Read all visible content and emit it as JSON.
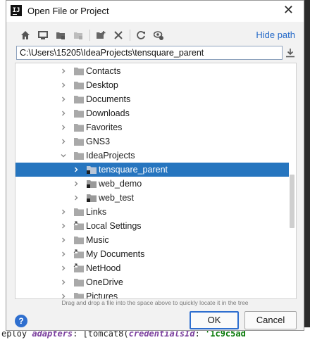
{
  "window": {
    "title": "Open File or Project",
    "app_icon_text": "IJ",
    "close_glyph": "✕"
  },
  "toolbar": {
    "icons": [
      "home-icon",
      "desktop-icon",
      "project-folder-icon",
      "module-folder-icon",
      "new-folder-icon",
      "delete-icon",
      "refresh-icon",
      "show-hidden-icon"
    ],
    "hide_path_label": "Hide path"
  },
  "path": {
    "value": "C:\\Users\\15205\\IdeaProjects\\tensquare_parent"
  },
  "tree": {
    "items": [
      {
        "label": "Contacts",
        "expanded": false,
        "selected": false
      },
      {
        "label": "Desktop",
        "expanded": false,
        "selected": false
      },
      {
        "label": "Documents",
        "expanded": false,
        "selected": false
      },
      {
        "label": "Downloads",
        "expanded": false,
        "selected": false
      },
      {
        "label": "Favorites",
        "expanded": false,
        "selected": false
      },
      {
        "label": "GNS3",
        "expanded": false,
        "selected": false
      },
      {
        "label": "IdeaProjects",
        "expanded": true,
        "selected": false
      },
      {
        "label": "tensquare_parent",
        "expanded": false,
        "selected": true
      },
      {
        "label": "web_demo",
        "expanded": false,
        "selected": false
      },
      {
        "label": "web_test",
        "expanded": false,
        "selected": false
      },
      {
        "label": "Links",
        "expanded": false,
        "selected": false
      },
      {
        "label": "Local Settings",
        "expanded": false,
        "selected": false
      },
      {
        "label": "Music",
        "expanded": false,
        "selected": false
      },
      {
        "label": "My Documents",
        "expanded": false,
        "selected": false
      },
      {
        "label": "NetHood",
        "expanded": false,
        "selected": false
      },
      {
        "label": "OneDrive",
        "expanded": false,
        "selected": false
      },
      {
        "label": "Pictures",
        "expanded": false,
        "selected": false
      }
    ]
  },
  "hint": "Drag and drop a file into the space above to quickly locate it in the tree",
  "buttons": {
    "help": "?",
    "ok": "OK",
    "cancel": "Cancel"
  },
  "background": {
    "code_prefix": "eploy ",
    "code_kw1": "adapters",
    "code_mid": ": [tomcat8(",
    "code_kw2": "credentialsId",
    "code_end": ": ",
    "code_str": "'1c9c5ad"
  },
  "colors": {
    "selection": "#2675bf",
    "link": "#2469c8",
    "accent_button": "#2f6fcf"
  }
}
